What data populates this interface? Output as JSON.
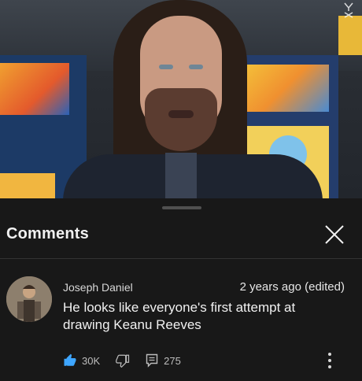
{
  "video": {
    "watermark_icon": "watermark-logo-icon"
  },
  "comments_panel": {
    "title": "Comments",
    "close_icon": "close-icon"
  },
  "comment": {
    "author": "Joseph Daniel",
    "meta": "2 years ago (edited)",
    "text": "He looks like everyone's first attempt at drawing Keanu Reeves",
    "likes": "30K",
    "replies": "275",
    "like_icon": "thumbs-up-icon",
    "dislike_icon": "thumbs-down-icon",
    "reply_icon": "reply-icon",
    "more_icon": "more-vertical-icon",
    "accent_color": "#3ea6ff"
  }
}
